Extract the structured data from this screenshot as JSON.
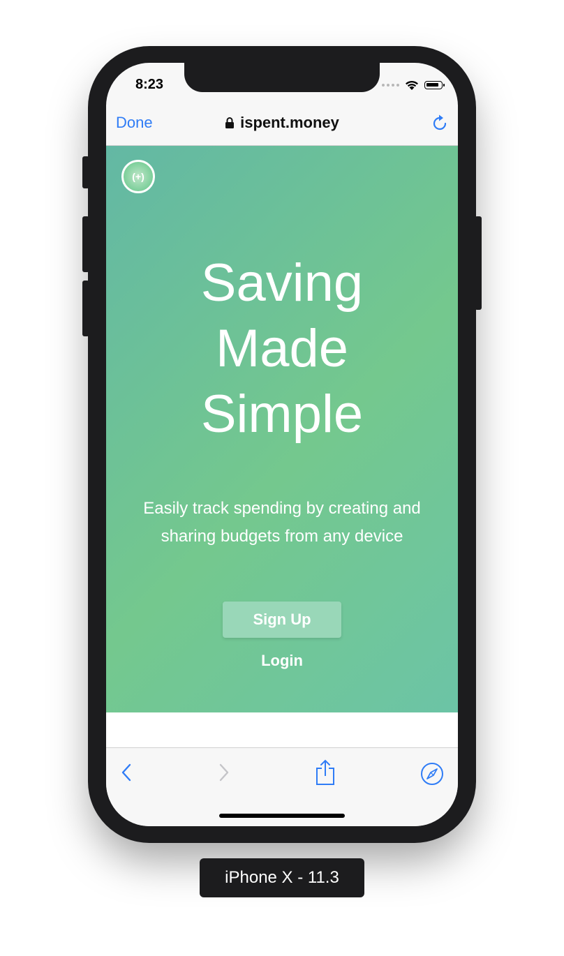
{
  "status_bar": {
    "time": "8:23"
  },
  "browser": {
    "done_label": "Done",
    "url": "ispent.money"
  },
  "hero": {
    "logo_text": "(+)",
    "title_lines": [
      "Saving",
      "Made",
      "Simple"
    ],
    "subtitle_lines": [
      "Easily track spending by creating and",
      "sharing budgets from any device"
    ],
    "signup_label": "Sign Up",
    "login_label": "Login"
  },
  "device": {
    "label": "iPhone X - 11.3"
  },
  "colors": {
    "accent_blue": "#2f7cf6",
    "hero_gradient_start": "#63b8a4",
    "hero_gradient_mid": "#74c88e",
    "signup_button": "#99d7b8"
  },
  "icons": {
    "lock": "lock-icon",
    "reload": "reload-icon",
    "back": "back-chevron-icon",
    "forward": "forward-chevron-icon",
    "share": "share-icon",
    "safari": "compass-icon"
  }
}
